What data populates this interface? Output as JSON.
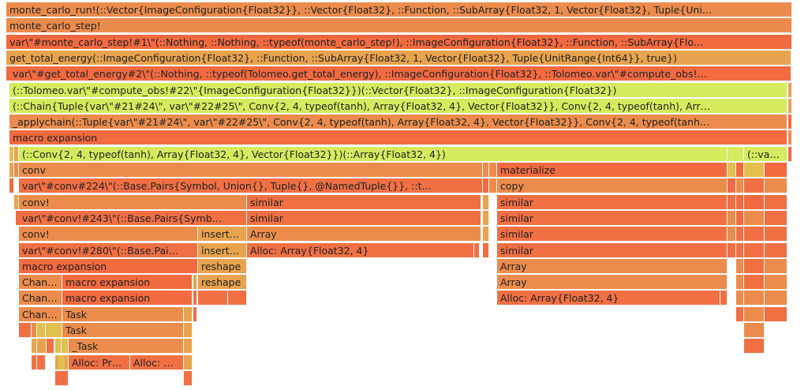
{
  "title": "Flame graph profile",
  "colors": {
    "orange": "#ec8c4c",
    "red": "#f26a40",
    "redorange": "#f07044",
    "amber": "#e8a34e",
    "green": "#d6ea5e",
    "yellow": "#e3c04e",
    "salmon": "#f0744a"
  },
  "frames": {
    "monte_carlo_run": "monte_carlo_run!(::Vector{ImageConfiguration{Float32}}, ::Vector{Float32}, ::Function, ::SubArray{Float32, 1, Vector{Float32}, Tuple{Uni…",
    "monte_carlo_step": "monte_carlo_step!",
    "monte_carlo_step_1": "var\\\"#monte_carlo_step!#1\\\"(::Nothing, ::Nothing, ::typeof(monte_carlo_step!), ::ImageConfiguration{Float32}, ::Function, ::SubArray{Flo…",
    "get_total_energy": "get_total_energy(::ImageConfiguration{Float32}, ::Function, ::SubArray{Float32, 1, Vector{Float32}, Tuple{UnitRange{Int64}}, true})",
    "get_total_energy_2": "var\\\"#get_total_energy#2\\\"(::Nothing, ::typeof(Tolomeo.get_total_energy), ::ImageConfiguration{Float32}, ::Tolomeo.var\\\"#compute_obs!…",
    "compute_obs": "(::Tolomeo.var\\\"#compute_obs!#22\\\"{ImageConfiguration{Float32}})(::Vector{Float32}, ::ImageConfiguration{Float32})",
    "chain": "(::Chain{Tuple{var\\\"#21#24\\\", var\\\"#22#25\\\", Conv{2, 4, typeof(tanh), Array{Float32, 4}, Vector{Float32}}, Conv{2, 4, typeof(tanh), Arr…",
    "applychain": "_applychain(::Tuple{var\\\"#21#24\\\", var\\\"#22#25\\\", Conv{2, 4, typeof(tanh), Array{Float32, 4}, Vector{Float32}}, Conv{2, 4, typeof(tanh…",
    "macro_expansion": "macro expansion",
    "conv_call": "(::Conv{2, 4, typeof(tanh), Array{Float32, 4}, Vector{Float32}})(::Array{Float32, 4})",
    "va": "(::va…",
    "conv": "conv",
    "materialize": "materialize",
    "conv_224": "var\\\"#conv#224\\\"(::Base.Pairs{Symbol, Union{}, Tuple{}, @NamedTuple{}}, ::t…",
    "copy": "copy",
    "conv_bang": "conv!",
    "similar": "similar",
    "conv_243": "var\\\"#conv!#243\\\"(::Base.Pairs{Symb…",
    "insert": "insert…",
    "array": "Array",
    "conv_280": "var\\\"#conv!#280\\\"(::Base.Pai…",
    "alloc_array": "Alloc: Array{Float32, 4}",
    "reshape": "reshape",
    "chan": "Chan…",
    "task": "Task",
    "_task": "_Task",
    "alloc_pr": "Alloc: Pr…",
    "alloc": "Alloc: …"
  }
}
